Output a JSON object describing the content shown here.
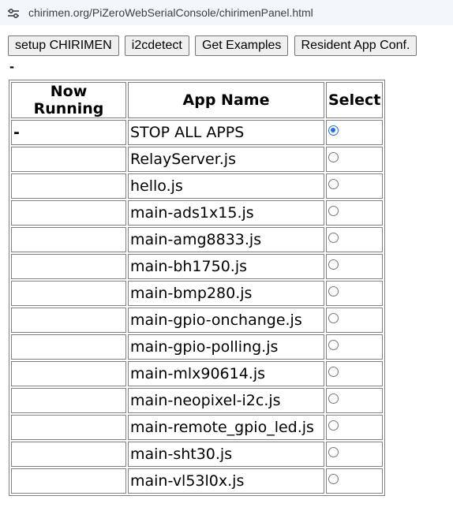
{
  "address_bar": {
    "url": "chirimen.org/PiZeroWebSerialConsole/chirimenPanel.html",
    "icon": "site-settings-icon"
  },
  "toolbar": {
    "buttons": [
      {
        "label": "setup CHIRIMEN"
      },
      {
        "label": "i2cdetect"
      },
      {
        "label": "Get Examples"
      },
      {
        "label": "Resident App Conf."
      }
    ]
  },
  "status_text": "-",
  "table": {
    "headers": [
      "Now Running",
      "App Name",
      "Select"
    ],
    "rows": [
      {
        "running": "-",
        "app": "STOP ALL APPS",
        "selected": true
      },
      {
        "running": "",
        "app": "RelayServer.js",
        "selected": false
      },
      {
        "running": "",
        "app": "hello.js",
        "selected": false
      },
      {
        "running": "",
        "app": "main-ads1x15.js",
        "selected": false
      },
      {
        "running": "",
        "app": "main-amg8833.js",
        "selected": false
      },
      {
        "running": "",
        "app": "main-bh1750.js",
        "selected": false
      },
      {
        "running": "",
        "app": "main-bmp280.js",
        "selected": false
      },
      {
        "running": "",
        "app": "main-gpio-onchange.js",
        "selected": false
      },
      {
        "running": "",
        "app": "main-gpio-polling.js",
        "selected": false
      },
      {
        "running": "",
        "app": "main-mlx90614.js",
        "selected": false
      },
      {
        "running": "",
        "app": "main-neopixel-i2c.js",
        "selected": false
      },
      {
        "running": "",
        "app": "main-remote_gpio_led.js",
        "selected": false
      },
      {
        "running": "",
        "app": "main-sht30.js",
        "selected": false
      },
      {
        "running": "",
        "app": "main-vl53l0x.js",
        "selected": false
      }
    ]
  },
  "colors": {
    "radio_accent": "#1a73e8",
    "address_bar_bg": "#f3f6fb"
  }
}
